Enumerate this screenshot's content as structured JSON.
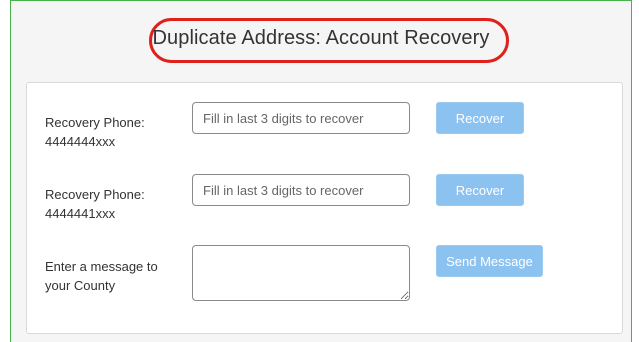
{
  "header": {
    "title": "Duplicate Address: Account Recovery",
    "highlight_color": "#e0201b"
  },
  "form": {
    "rows": [
      {
        "label": "Recovery Phone:",
        "sublabel": "4444444xxx",
        "placeholder": "Fill in last 3 digits to recover",
        "value": "",
        "button_label": "Recover"
      },
      {
        "label": "Recovery Phone:",
        "sublabel": "4444441xxx",
        "placeholder": "Fill in last 3 digits to recover",
        "value": "",
        "button_label": "Recover"
      }
    ],
    "message": {
      "label_line1": "Enter a message to",
      "label_line2": "your County",
      "value": "",
      "button_label": "Send Message"
    }
  },
  "colors": {
    "frame_border": "#46b34c",
    "button_bg": "#8cc2f0",
    "button_text": "#ffffff"
  }
}
